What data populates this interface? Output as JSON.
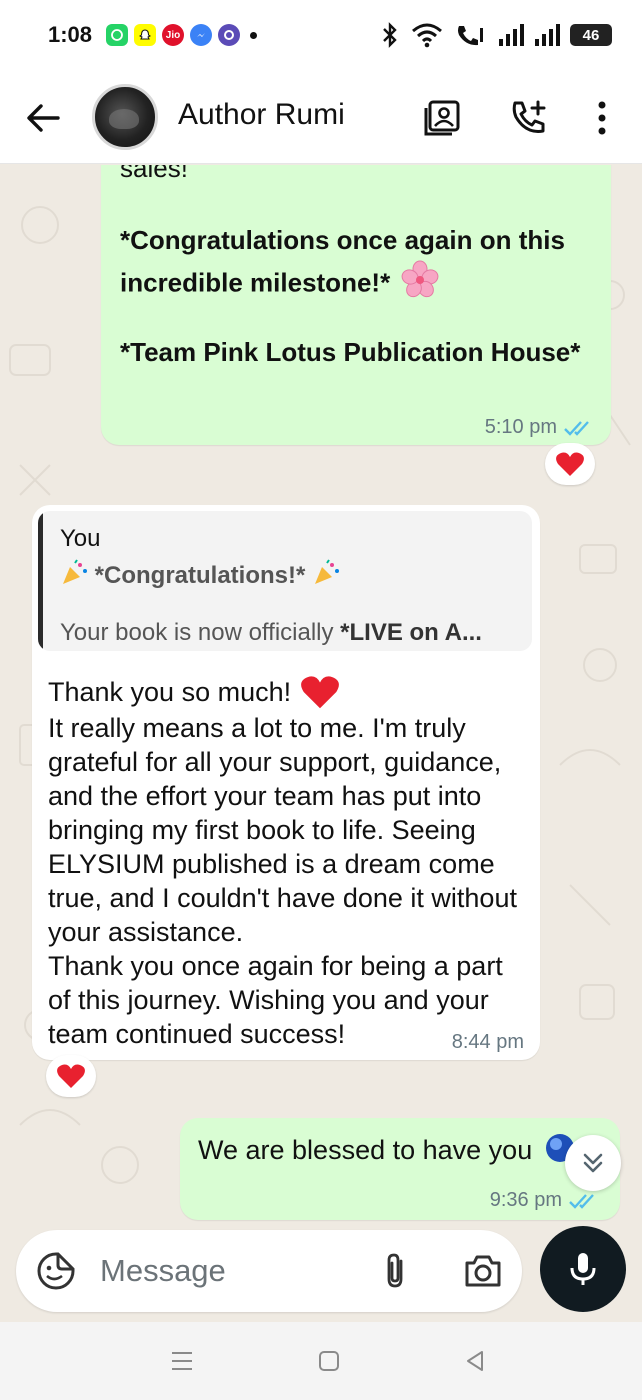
{
  "status_bar": {
    "time": "1:08",
    "battery": "46",
    "apps": [
      {
        "name": "whatsapp-icon",
        "color": "#25d366",
        "label": ""
      },
      {
        "name": "snapchat-icon",
        "color": "#fffc00",
        "label": ""
      },
      {
        "name": "jio-icon",
        "color": "#e0112b",
        "label": "Jio"
      },
      {
        "name": "messenger-icon",
        "color": "#3b82f6",
        "label": ""
      },
      {
        "name": "app-icon",
        "color": "#5b4bb7",
        "label": ""
      }
    ]
  },
  "header": {
    "contact_name": "Author Rumi"
  },
  "messages": {
    "m1": {
      "para1": "sales!",
      "para2_bold": "*Congratulations once again on this incredible milestone!*",
      "para3_bold": "*Team Pink Lotus Publication House*",
      "time": "5:10 pm",
      "status": "read"
    },
    "m2": {
      "quote_author": "You",
      "quote_line1": "*Congratulations!*",
      "quote_line2_prefix": "Your book is now officially ",
      "quote_line2_bold": "*LIVE on A...",
      "first_line": "Thank you so much!",
      "body": "It really means a lot to me. I'm truly grateful for all your support, guidance, and the effort your team has put into bringing my first book to life. Seeing ELYSIUM published is a dream come true, and I couldn't have done it without your assistance.\nThank you once again for being a part of this journey. Wishing you and your team continued success!",
      "time": "8:44 pm"
    },
    "m3": {
      "text": "We are blessed to have you",
      "time": "9:36 pm",
      "status": "read"
    }
  },
  "composer": {
    "placeholder": "Message"
  },
  "colors": {
    "outgoing_bubble": "#d9fdd3",
    "incoming_bubble": "#ffffff",
    "read_ticks": "#53bdeb",
    "chat_bg": "#efeae2"
  }
}
